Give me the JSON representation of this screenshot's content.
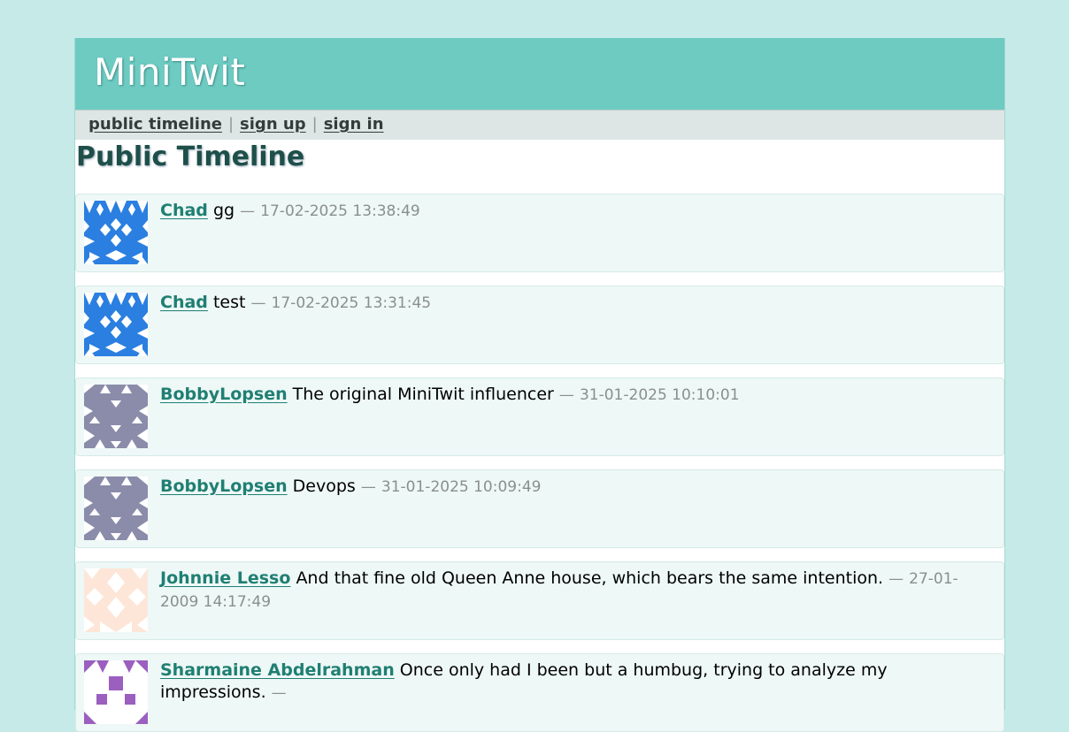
{
  "header": {
    "title": "MiniTwit"
  },
  "navigation": {
    "public_timeline": "public timeline",
    "sign_up": "sign up",
    "sign_in": "sign in",
    "separator": "|"
  },
  "main": {
    "heading": "Public Timeline"
  },
  "messages": [
    {
      "user": "Chad",
      "text": "gg",
      "dash": "—",
      "date": "17-02-2025 13:38:49",
      "avatar_icon": "identicon-blue"
    },
    {
      "user": "Chad",
      "text": "test",
      "dash": "—",
      "date": "17-02-2025 13:31:45",
      "avatar_icon": "identicon-blue"
    },
    {
      "user": "BobbyLopsen",
      "text": "The original MiniTwit influencer",
      "dash": "—",
      "date": "31-01-2025 10:10:01",
      "avatar_icon": "identicon-grey-purple"
    },
    {
      "user": "BobbyLopsen",
      "text": "Devops",
      "dash": "—",
      "date": "31-01-2025 10:09:49",
      "avatar_icon": "identicon-grey-purple"
    },
    {
      "user": "Johnnie Lesso",
      "text": "And that fine old Queen Anne house, which bears the same intention.",
      "dash": "—",
      "date": "27-01-2009 14:17:49",
      "avatar_icon": "identicon-peach"
    },
    {
      "user": "Sharmaine Abdelrahman",
      "text": "Once only had I been but a humbug, trying to analyze my impressions.",
      "dash": "—",
      "date": "",
      "avatar_icon": "identicon-purple"
    }
  ],
  "colors": {
    "background": "#c6eae7",
    "header": "#6ecbc2",
    "link": "#1f7f73",
    "avatar_blue": "#2a7fe0",
    "avatar_grey": "#8a8caa",
    "avatar_peach": "#fde6d8",
    "avatar_purple": "#9b5fc0"
  }
}
